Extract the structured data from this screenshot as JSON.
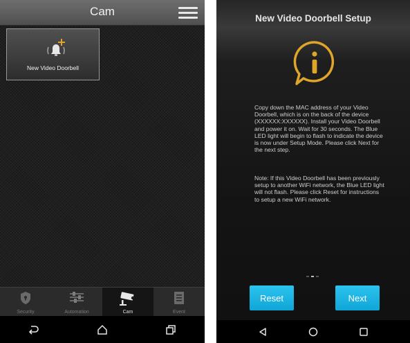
{
  "left": {
    "header": {
      "title": "Cam"
    },
    "tile": {
      "label": "New Video Doorbell",
      "icon": "doorbell-add-icon"
    },
    "tabs": [
      {
        "label": "Security",
        "icon": "shield-icon",
        "active": false
      },
      {
        "label": "Automation",
        "icon": "sliders-icon",
        "active": false
      },
      {
        "label": "Cam",
        "icon": "camera-icon",
        "active": true
      },
      {
        "label": "Event",
        "icon": "list-icon",
        "active": false
      }
    ],
    "nav": [
      "back-icon",
      "home-icon",
      "recents-icon"
    ]
  },
  "right": {
    "title": "New Video Doorbell Setup",
    "icon": "info-icon",
    "accent_color": "#e0a62a",
    "description": "Copy down the MAC address of your Video Doorbell, which is on the back of the device (XXXXXX:XXXXXX). Install your Video Doorbell and power it on. Wait for 30 seconds. The Blue LED light will begin to flash to indicate the device is now under Setup Mode. Please click Next for the next step.",
    "note": "Note: If this Video Doorbell has been previously setup to another WiFi network, the Blue LED light will not flash. Please click Reset for instructions to setup a new WiFi network.",
    "buttons": {
      "reset": "Reset",
      "next": "Next"
    },
    "button_color": "#1bb3e4",
    "nav": [
      "back-icon",
      "home-icon",
      "recents-icon"
    ]
  }
}
